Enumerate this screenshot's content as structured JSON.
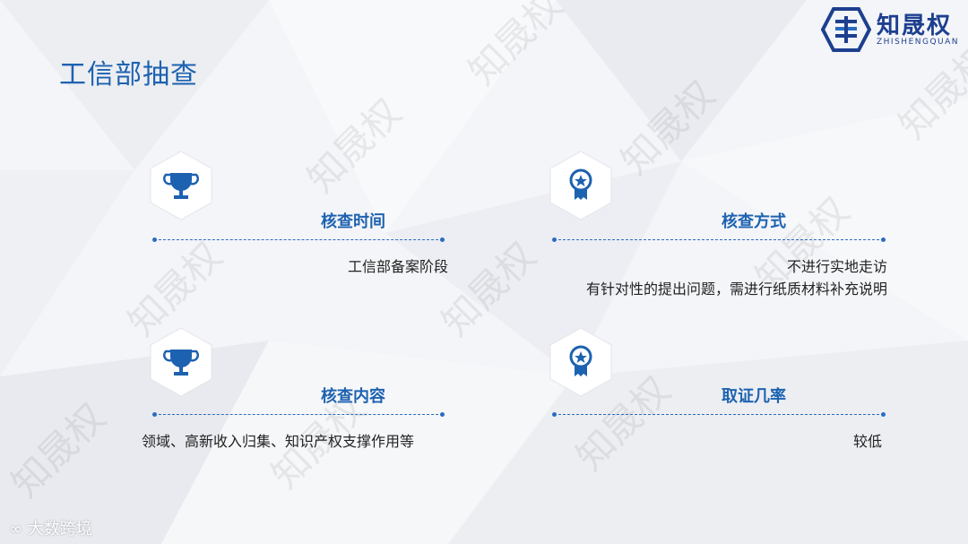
{
  "slide": {
    "title": "工信部抽查",
    "logo": {
      "name": "知晟权",
      "subtitle": "ZHISHENGQUAN"
    },
    "watermark": "知晟权",
    "footer": "大数跨境",
    "cards": [
      {
        "icon": "trophy-icon",
        "title": "核查时间",
        "lines": [
          "工信部备案阶段"
        ]
      },
      {
        "icon": "award-icon",
        "title": "核查方式",
        "lines": [
          "不进行实地走访",
          "有针对性的提出问题，需进行纸质材料补充说明"
        ]
      },
      {
        "icon": "trophy-icon",
        "title": "核查内容",
        "lines": [
          "领域、高新收入归集、知识产权支撑作用等"
        ]
      },
      {
        "icon": "award-icon",
        "title": "取证几率",
        "lines": [
          "较低"
        ]
      }
    ],
    "colors": {
      "accent": "#1d62b0",
      "logo": "#1d3f8f",
      "text": "#222222"
    }
  }
}
